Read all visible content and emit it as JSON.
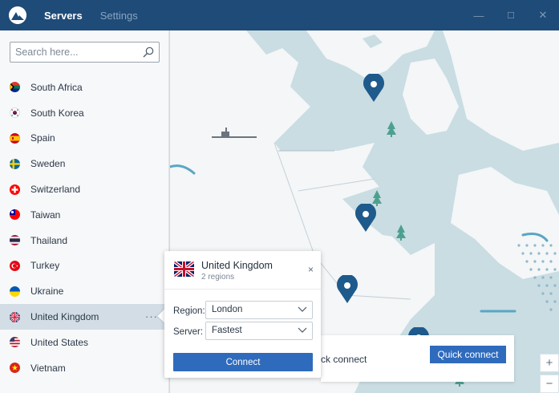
{
  "titlebar": {
    "tabs": [
      {
        "label": "Servers",
        "active": true
      },
      {
        "label": "Settings",
        "active": false
      }
    ],
    "controls": {
      "minimize": "—",
      "maximize": "☐",
      "close": "✕"
    }
  },
  "sidebar": {
    "search_placeholder": "Search here...",
    "items": [
      {
        "label": "South Africa",
        "icon": "flag-south-africa"
      },
      {
        "label": "South Korea",
        "icon": "flag-south-korea"
      },
      {
        "label": "Spain",
        "icon": "flag-spain"
      },
      {
        "label": "Sweden",
        "icon": "flag-sweden"
      },
      {
        "label": "Switzerland",
        "icon": "flag-switzerland"
      },
      {
        "label": "Taiwan",
        "icon": "flag-taiwan"
      },
      {
        "label": "Thailand",
        "icon": "flag-thailand"
      },
      {
        "label": "Turkey",
        "icon": "flag-turkey"
      },
      {
        "label": "Ukraine",
        "icon": "flag-ukraine"
      },
      {
        "label": "United Kingdom",
        "icon": "flag-uk",
        "selected": true,
        "more": "···"
      },
      {
        "label": "United States",
        "icon": "flag-usa"
      },
      {
        "label": "Vietnam",
        "icon": "flag-vietnam"
      }
    ]
  },
  "popup": {
    "title": "United Kingdom",
    "subtitle": "2 regions",
    "close": "×",
    "region_label": "Region:",
    "region_value": "London",
    "server_label": "Server:",
    "server_value": "Fastest",
    "connect_label": "Connect"
  },
  "quick_connect": {
    "text": "ck connect",
    "button": "Quick connect"
  },
  "zoom": {
    "in": "+",
    "out": "−"
  },
  "colors": {
    "titlebar": "#1f4b78",
    "accent": "#2e6bbd",
    "map_water": "#c9dde3",
    "map_land": "#f4f6f7",
    "pin": "#1e5a8c"
  }
}
